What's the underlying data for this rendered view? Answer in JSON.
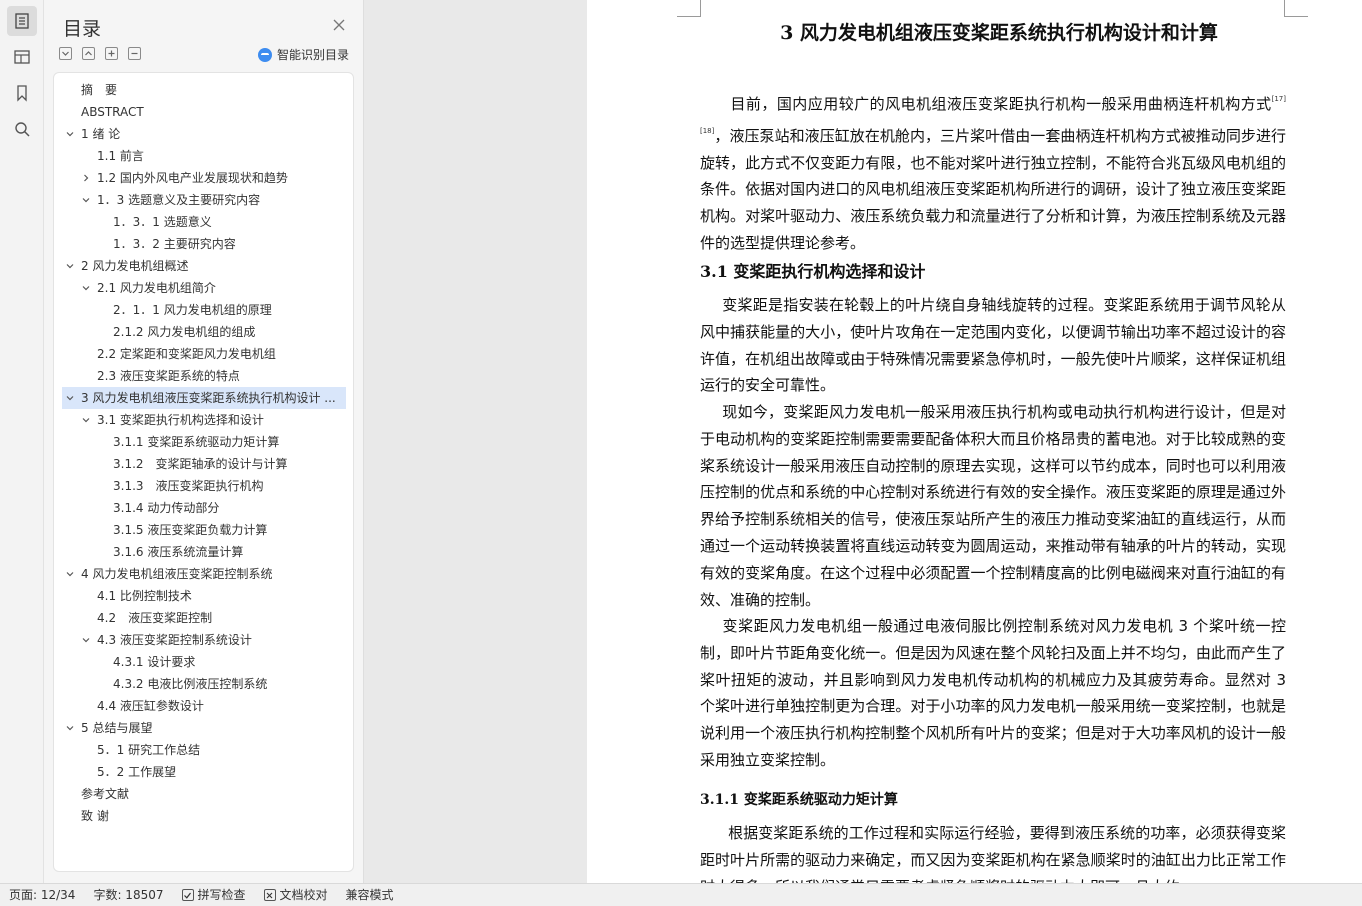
{
  "toc": {
    "title": "目录",
    "smart_label": "智能识别目录",
    "items": [
      {
        "label": "摘　要",
        "level": 1,
        "arrow": "none"
      },
      {
        "label": "ABSTRACT",
        "level": 1,
        "arrow": "none"
      },
      {
        "label": "1 绪 论",
        "level": 1,
        "arrow": "down"
      },
      {
        "label": "1.1 前言",
        "level": 2,
        "arrow": "none"
      },
      {
        "label": "1.2 国内外风电产业发展现状和趋势",
        "level": 2,
        "arrow": "right"
      },
      {
        "label": "1．3 选题意义及主要研究内容",
        "level": 2,
        "arrow": "down"
      },
      {
        "label": "1．3．1 选题意义",
        "level": 3,
        "arrow": "none"
      },
      {
        "label": "1．3．2 主要研究内容",
        "level": 3,
        "arrow": "none"
      },
      {
        "label": "2 风力发电机组概述",
        "level": 1,
        "arrow": "down"
      },
      {
        "label": "2.1 风力发电机组简介",
        "level": 2,
        "arrow": "down"
      },
      {
        "label": "2．1．1 风力发电机组的原理",
        "level": 3,
        "arrow": "none"
      },
      {
        "label": "2.1.2 风力发电机组的组成",
        "level": 3,
        "arrow": "none"
      },
      {
        "label": "2.2 定桨距和变桨距风力发电机组",
        "level": 2,
        "arrow": "none"
      },
      {
        "label": "2.3 液压变桨距系统的特点",
        "level": 2,
        "arrow": "none"
      },
      {
        "label": "3 风力发电机组液压变桨距系统执行机构设计 ...",
        "level": 1,
        "arrow": "down",
        "selected": true
      },
      {
        "label": "3.1 变桨距执行机构选择和设计",
        "level": 2,
        "arrow": "down"
      },
      {
        "label": "3.1.1 变桨距系统驱动力矩计算",
        "level": 3,
        "arrow": "none"
      },
      {
        "label": "3.1.2　变桨距轴承的设计与计算",
        "level": 3,
        "arrow": "none"
      },
      {
        "label": "3.1.3　液压变桨距执行机构",
        "level": 3,
        "arrow": "none"
      },
      {
        "label": "3.1.4 动力传动部分",
        "level": 3,
        "arrow": "none"
      },
      {
        "label": "3.1.5 液压变桨距负载力计算",
        "level": 3,
        "arrow": "none"
      },
      {
        "label": "3.1.6 液压系统流量计算",
        "level": 3,
        "arrow": "none"
      },
      {
        "label": "4 风力发电机组液压变桨距控制系统",
        "level": 1,
        "arrow": "down"
      },
      {
        "label": "4.1 比例控制技术",
        "level": 2,
        "arrow": "none"
      },
      {
        "label": "4.2　液压变桨距控制",
        "level": 2,
        "arrow": "none"
      },
      {
        "label": "4.3 液压变桨距控制系统设计",
        "level": 2,
        "arrow": "down"
      },
      {
        "label": "4.3.1 设计要求",
        "level": 3,
        "arrow": "none"
      },
      {
        "label": "4.3.2 电液比例液压控制系统",
        "level": 3,
        "arrow": "none"
      },
      {
        "label": "4.4 液压缸参数设计",
        "level": 2,
        "arrow": "none"
      },
      {
        "label": "5 总结与展望",
        "level": 1,
        "arrow": "down"
      },
      {
        "label": "5．1 研究工作总结",
        "level": 2,
        "arrow": "none"
      },
      {
        "label": "5．2 工作展望",
        "level": 2,
        "arrow": "none"
      },
      {
        "label": "参考文献",
        "level": 1,
        "arrow": "none"
      },
      {
        "label": "致 谢",
        "level": 1,
        "arrow": "none"
      }
    ]
  },
  "doc": {
    "chapter_title": "3  风力发电机组液压变桨距系统执行机构设计和计算",
    "p1_a": "目前，国内应用较广的风电机组液压变桨距执行机构一般采用曲柄连杆机构方式",
    "p1_sup": "[17][18]",
    "p1_b": "，液压泵站和液压缸放在机舱内，三片桨叶借由一套曲柄连杆机构方式被推动同步进行旋转，此方式不仅变距力有限，也不能对桨叶进行独立控制，不能符合兆瓦级风电机组的条件。依据对国内进口的风电机组液压变桨距机构所进行的调研，设计了独立液压变桨距机构。对桨叶驱动力、液压系统负载力和流量进行了分析和计算，为液压控制系统及元器件的选型提供理论参考。",
    "sec_title": "3.1  变桨距执行机构选择和设计",
    "p2": "变桨距是指安装在轮毂上的叶片绕自身轴线旋转的过程。变桨距系统用于调节风轮从风中捕获能量的大小，使叶片攻角在一定范围内变化，以便调节输出功率不超过设计的容许值，在机组出故障或由于特殊情况需要紧急停机时，一般先使叶片顺桨，这样保证机组运行的安全可靠性。",
    "p3": "现如今，变桨距风力发电机一般采用液压执行机构或电动执行机构进行设计，但是对于电动机构的变桨距控制需要需要配备体积大而且价格昂贵的蓄电池。对于比较成熟的变桨系统设计一般采用液压自动控制的原理去实现，这样可以节约成本，同时也可以利用液压控制的优点和系统的中心控制对系统进行有效的安全操作。液压变桨距的原理是通过外界给予控制系统相关的信号，使液压泵站所产生的液压力推动变桨油缸的直线运行，从而通过一个运动转换装置将直线运动转变为圆周运动，来推动带有轴承的叶片的转动，实现有效的变桨角度。在这个过程中必须配置一个控制精度高的比例电磁阀来对直行油缸的有效、准确的控制。",
    "p4": "变桨距风力发电机组一般通过电液伺服比例控制系统对风力发电机 3 个桨叶统一控制，即叶片节距角变化统一。但是因为风速在整个风轮扫及面上并不均匀，由此而产生了桨叶扭矩的波动，并且影响到风力发电机传动机构的机械应力及其疲劳寿命。显然对 3 个桨叶进行单独控制更为合理。对于小功率的风力发电机一般采用统一变桨控制，也就是说利用一个液压执行机构控制整个风机所有叶片的变桨；但是对于大功率风机的设计一般采用独立变桨控制。",
    "subsec_title": "3.1.1  变桨距系统驱动力矩计算",
    "p5": "根据变桨距系统的工作过程和实际运行经验，要得到液压系统的功率，必须获得变桨距时叶片所需的驱动力来确定，而又因为变桨距机构在紧急顺桨时的油缸出力比正常工作时大得多，所以我们通常只需要考虑紧急顺桨时的驱动力大即可，且大约"
  },
  "status": {
    "page": "页面: 12/34",
    "words": "字数: 18507",
    "spell": "拼写检查",
    "proof": "文档校对",
    "compat": "兼容模式"
  },
  "icons": [
    "toc-icon",
    "outline-icon",
    "bookmark-icon",
    "search-icon",
    "close-icon",
    "collapse-all-icon",
    "expand-up-icon",
    "add-icon",
    "remove-icon",
    "ai-icon",
    "checkbox-icon",
    "proofread-icon"
  ]
}
